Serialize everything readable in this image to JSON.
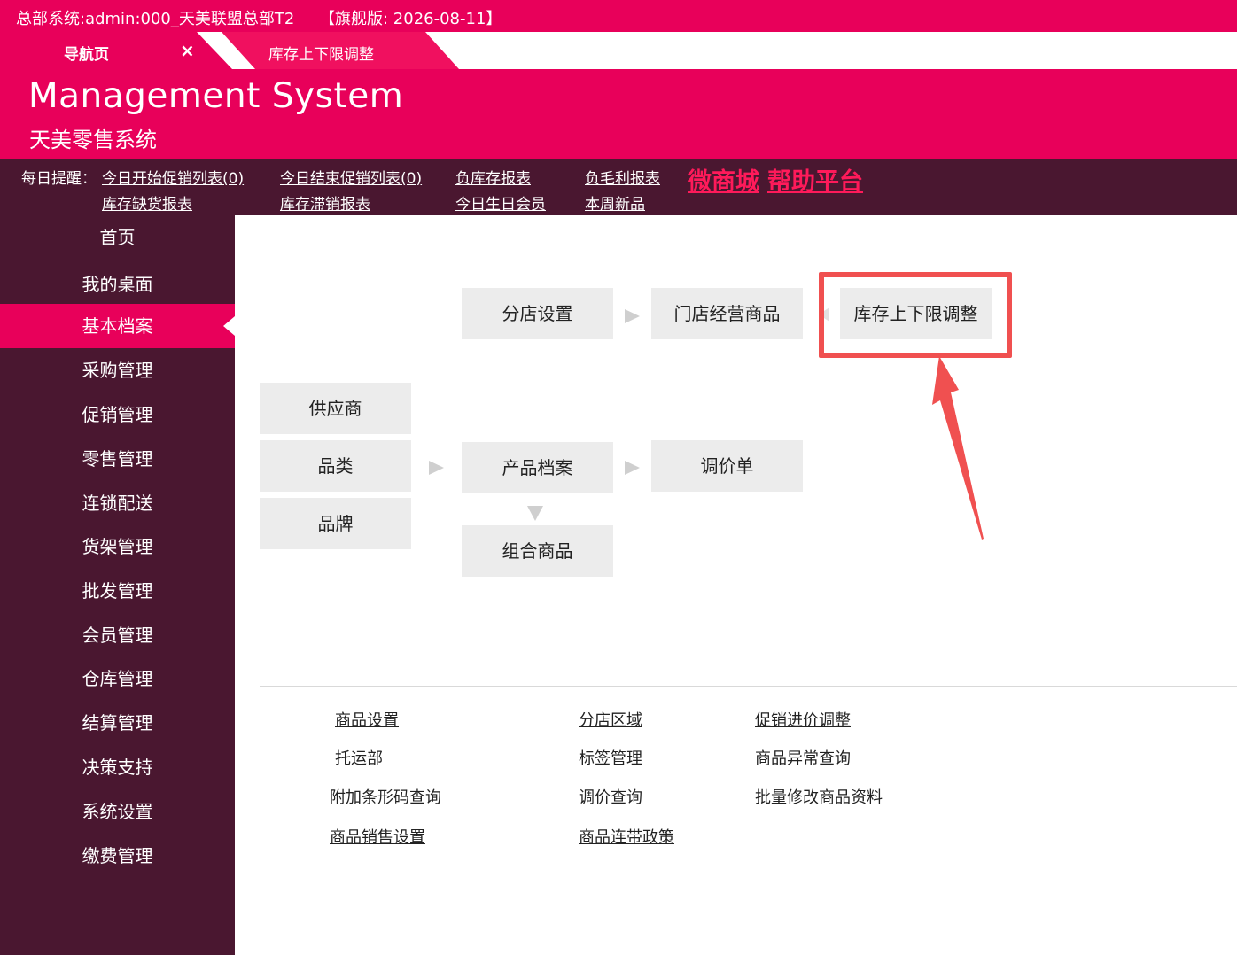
{
  "window": {
    "title": "总部系统:admin:000_天美联盟总部T2",
    "edition": "【旗舰版: 2026-08-11】"
  },
  "tabs": [
    {
      "label": "导航页",
      "close": "×"
    },
    {
      "label": "库存上下限调整"
    }
  ],
  "banner": {
    "brand": "Management System",
    "subtitle": "天美零售系统"
  },
  "reminder": {
    "prefix": "每日提醒：",
    "links": [
      "今日开始促销列表(0)",
      "今日结束促销列表(0)",
      "负库存报表",
      "负毛利报表",
      "库存缺货报表",
      "库存滞销报表",
      "今日生日会员",
      "本周新品"
    ],
    "highlight_links": [
      "微商城",
      "帮助平台"
    ]
  },
  "sidebar": {
    "items": [
      "首页",
      "我的桌面",
      "基本档案",
      "采购管理",
      "促销管理",
      "零售管理",
      "连锁配送",
      "货架管理",
      "批发管理",
      "会员管理",
      "仓库管理",
      "结算管理",
      "决策支持",
      "系统设置",
      "缴费管理"
    ],
    "active_index": 2
  },
  "flow": {
    "store_settings": "分店设置",
    "store_products": "门店经营商品",
    "stock_limits": "库存上下限调整",
    "supplier": "供应商",
    "category": "品类",
    "brand": "品牌",
    "product_file": "产品档案",
    "price_adjust": "调价单",
    "bundle": "组合商品"
  },
  "quick_links": {
    "col1": [
      "商品设置",
      "托运部",
      "附加条形码查询",
      "商品销售设置"
    ],
    "col2": [
      "分店区域",
      "标签管理",
      "调价查询",
      "商品连带政策"
    ],
    "col3": [
      "促销进价调整",
      "商品异常查询",
      "批量修改商品资料"
    ]
  },
  "colors": {
    "brand_pink": "#e8005a",
    "sidebar_dark": "#4a1730",
    "highlight_red": "#f05050",
    "box_gray": "#ececec"
  }
}
